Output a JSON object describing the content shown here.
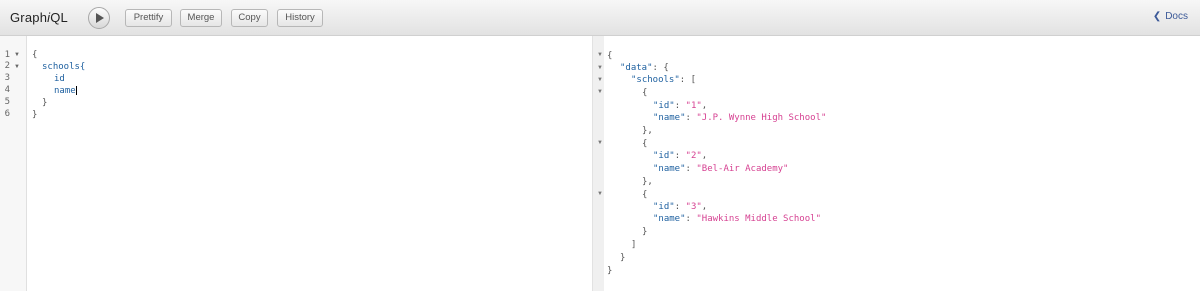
{
  "app": {
    "title_prefix": "Graph",
    "title_italic": "i",
    "title_suffix": "QL"
  },
  "toolbar": {
    "run_icon": "play-icon",
    "prettify_label": "Prettify",
    "merge_label": "Merge",
    "copy_label": "Copy",
    "history_label": "History",
    "docs_label": "Docs",
    "docs_icon": "chevron-left-icon"
  },
  "query": {
    "line_numbers": [
      "1",
      "2",
      "3",
      "4",
      "5",
      "6"
    ],
    "lines": [
      {
        "text": "{"
      },
      {
        "text": "schools{"
      },
      {
        "text": "id"
      },
      {
        "text": "name"
      },
      {
        "text": "}"
      },
      {
        "text": "}"
      }
    ]
  },
  "result": {
    "lines": [
      {
        "text": "{"
      },
      {
        "key": "\"data\"",
        "rest": ": {"
      },
      {
        "key": "\"schools\"",
        "rest": ": ["
      },
      {
        "text": "{"
      },
      {
        "key": "\"id\"",
        "sep": ": ",
        "val": "\"1\"",
        "rest": ","
      },
      {
        "key": "\"name\"",
        "sep": ": ",
        "val": "\"J.P. Wynne High School\"",
        "rest": ""
      },
      {
        "text": "},"
      },
      {
        "text": "{"
      },
      {
        "key": "\"id\"",
        "sep": ": ",
        "val": "\"2\"",
        "rest": ","
      },
      {
        "key": "\"name\"",
        "sep": ": ",
        "val": "\"Bel-Air Academy\"",
        "rest": ""
      },
      {
        "text": "},"
      },
      {
        "text": "{"
      },
      {
        "key": "\"id\"",
        "sep": ": ",
        "val": "\"3\"",
        "rest": ","
      },
      {
        "key": "\"name\"",
        "sep": ": ",
        "val": "\"Hawkins Middle School\"",
        "rest": ""
      },
      {
        "text": "}"
      },
      {
        "text": "]"
      },
      {
        "text": "}"
      },
      {
        "text": "}"
      }
    ]
  }
}
